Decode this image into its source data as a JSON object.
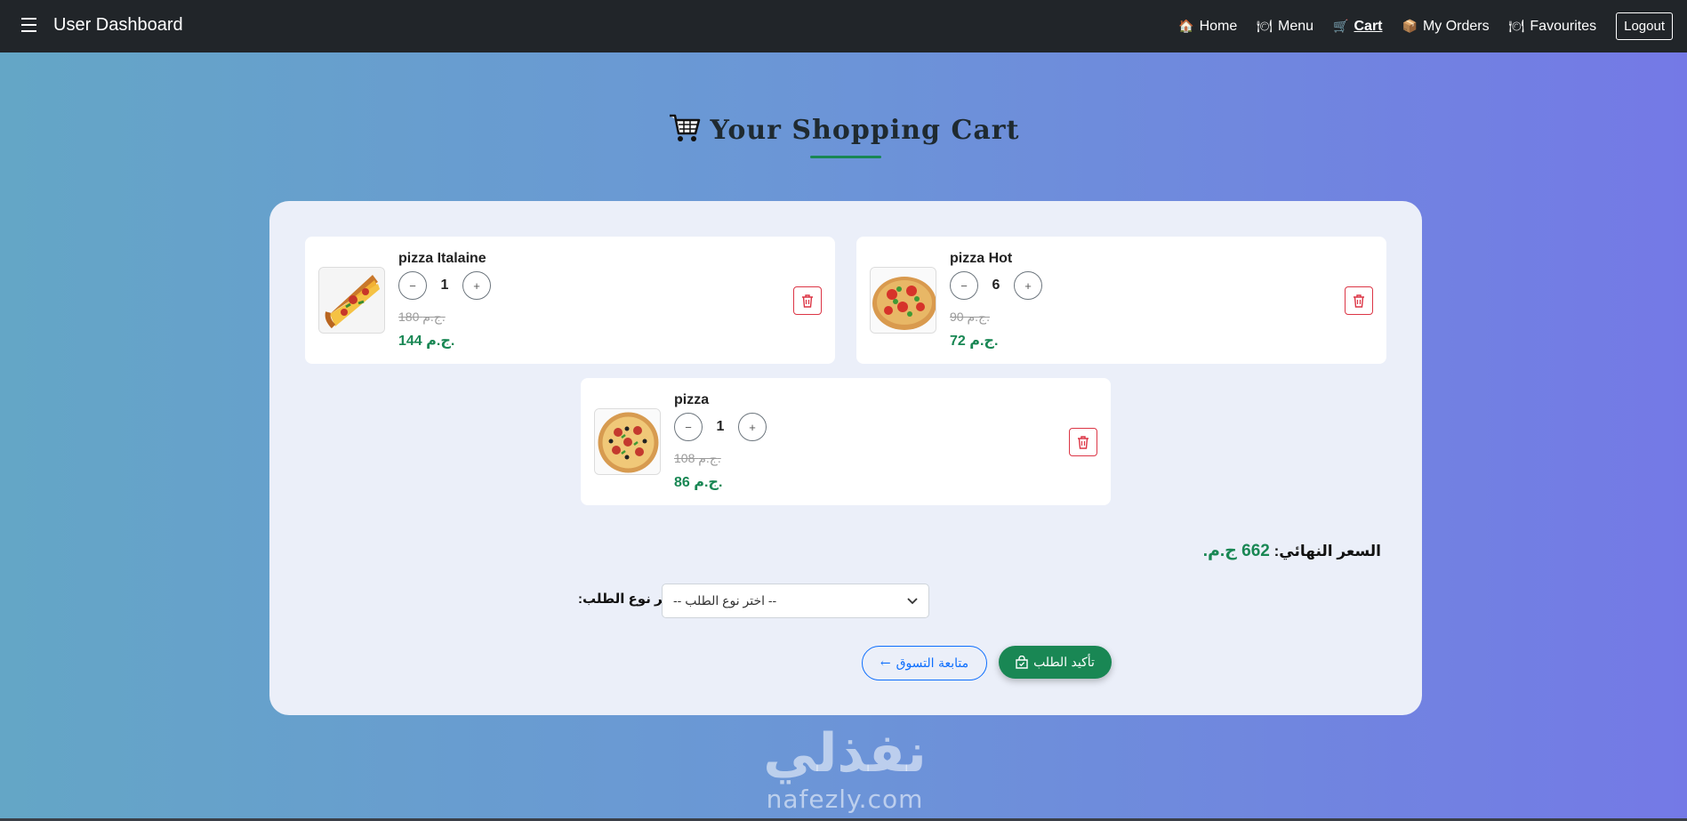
{
  "navbar": {
    "brand": "User Dashboard",
    "links": [
      {
        "label": "Home",
        "icon": "house-icon",
        "glyph": "🏠"
      },
      {
        "label": "Menu",
        "icon": "plate-icon",
        "glyph": "🍽"
      },
      {
        "label": "Cart",
        "icon": "cart-icon",
        "glyph": "🛒",
        "active": true
      },
      {
        "label": "My Orders",
        "icon": "box-icon",
        "glyph": "📦"
      },
      {
        "label": "Favourites",
        "icon": "plate-icon",
        "glyph": "🍽"
      }
    ],
    "logout": "Logout"
  },
  "page": {
    "title": "Your Shopping Cart"
  },
  "cart": {
    "items": [
      {
        "name": "pizza Italaine",
        "quantity": "1",
        "old_price": "180 ج.م.",
        "new_price": "144 ج.م."
      },
      {
        "name": "pizza Hot",
        "quantity": "6",
        "old_price": "90 ج.م.",
        "new_price": "72 ج.م."
      },
      {
        "name": "pizza",
        "quantity": "1",
        "old_price": "108 ج.م.",
        "new_price": "86 ج.م."
      }
    ],
    "total_label": "السعر النهائي:",
    "total_amount": "662 ج.م.",
    "order_type_label": "اختر نوع الطلب:",
    "order_type_selected": "-- اختر نوع الطلب --",
    "continue_label": "متابعة التسوق",
    "confirm_label": "تأكيد الطلب"
  },
  "watermark": {
    "arabic": "نفذلي",
    "english": "nafezly.com"
  },
  "colors": {
    "navbar": "#212529",
    "success": "#198754",
    "danger": "#dc3545",
    "primary": "#0d6efd"
  }
}
